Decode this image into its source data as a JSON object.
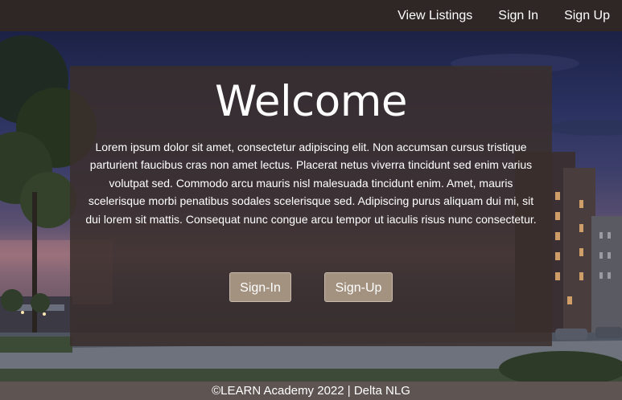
{
  "navbar": {
    "links": [
      "View Listings",
      "Sign In",
      "Sign Up"
    ]
  },
  "hero": {
    "title": "Welcome",
    "body": "Lorem ipsum dolor sit amet, consectetur adipiscing elit. Non accumsan cursus tristique parturient faucibus cras non amet lectus. Placerat netus viverra tincidunt sed enim varius volutpat sed. Commodo arcu mauris nisl malesuada tincidunt enim. Amet, mauris scelerisque morbi penatibus sodales scelerisque sed. Adipiscing purus aliquam dui mi, sit dui lorem sit mattis. Consequat nunc congue arcu tempor ut iaculis risus nunc consectetur.",
    "signin_button": "Sign-In",
    "signup_button": "Sign-Up"
  },
  "footer": {
    "text": "©LEARN Academy 2022 | Delta NLG"
  },
  "colors": {
    "navbar_bg": "#2f2725",
    "card_bg": "#3a2e2c",
    "button_bg": "#a39280",
    "footer_bg": "#5e5553"
  }
}
